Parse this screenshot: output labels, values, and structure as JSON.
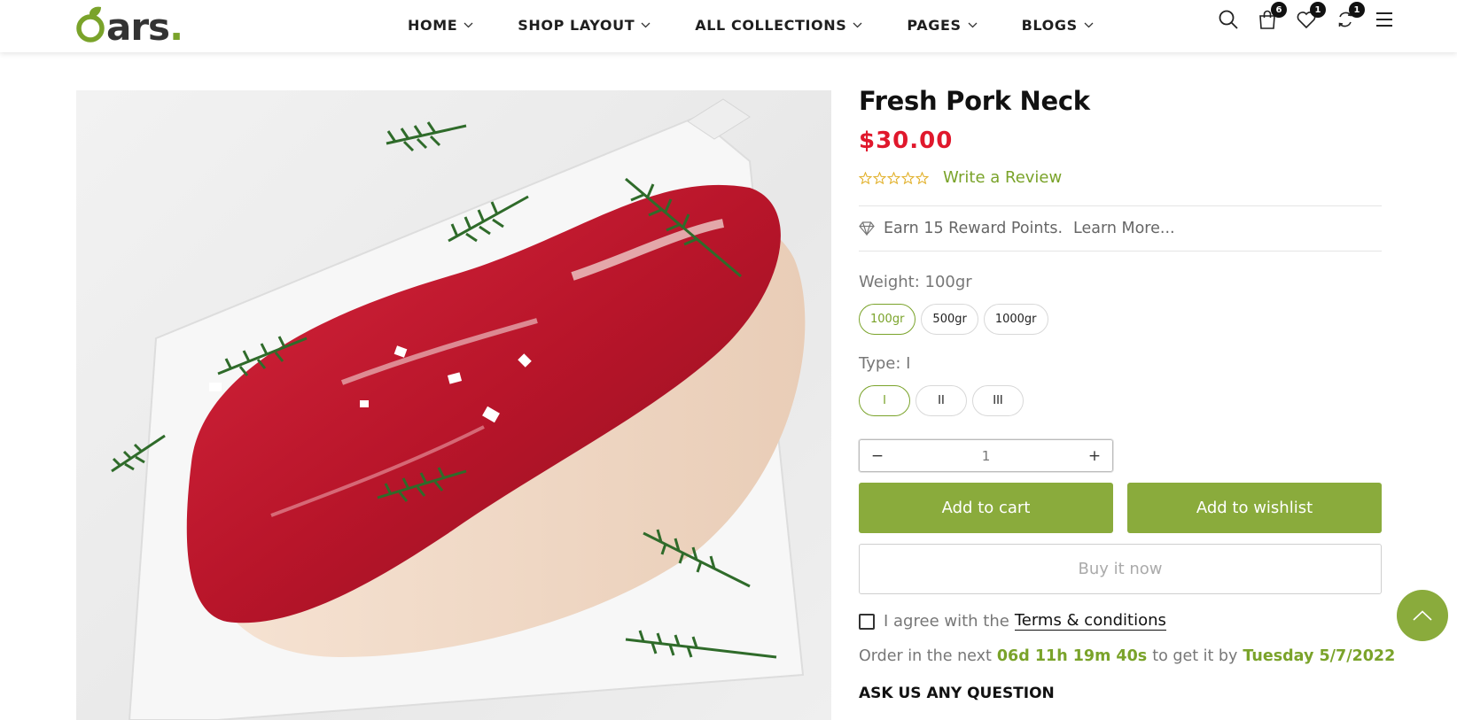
{
  "brand": {
    "logo_text": "ars",
    "logo_dot": ".",
    "accent_color": "#7aa32a",
    "price_color": "#e0182c"
  },
  "nav": {
    "items": [
      {
        "label": "HOME"
      },
      {
        "label": "SHOP LAYOUT"
      },
      {
        "label": "ALL COLLECTIONS"
      },
      {
        "label": "PAGES"
      },
      {
        "label": "BLOGS"
      }
    ]
  },
  "header_icons": {
    "search": "search-icon",
    "cart": {
      "icon": "cart-icon",
      "count": "6"
    },
    "wishlist": {
      "icon": "heart-icon",
      "count": "1"
    },
    "compare": {
      "icon": "compare-icon",
      "count": "1"
    },
    "menu": "menu-icon"
  },
  "product": {
    "title": "Fresh Pork Neck",
    "price": "$30.00",
    "rating": 0,
    "rating_max": 5,
    "review_link": "Write a Review",
    "reward_text": "Earn 15 Reward Points.",
    "reward_link": "Learn More...",
    "weight_label": "Weight: 100gr",
    "weight_options": [
      "100gr",
      "500gr",
      "1000gr"
    ],
    "weight_selected": "100gr",
    "type_label": "Type: I",
    "type_options": [
      "I",
      "II",
      "III"
    ],
    "type_selected": "I",
    "quantity": {
      "minus": "−",
      "value": "1",
      "plus": "+"
    },
    "add_to_cart": "Add to cart",
    "add_to_wishlist": "Add to wishlist",
    "buy_now": "Buy it now",
    "agree_text": "I agree with the",
    "terms_link": "Terms & conditions",
    "order_prefix": "Order in the next",
    "order_countdown": "06d 11h 19m 40s",
    "order_middle": "to get it by",
    "order_date": "Tuesday 5/7/2022",
    "ask_heading": "ASK US ANY QUESTION"
  }
}
